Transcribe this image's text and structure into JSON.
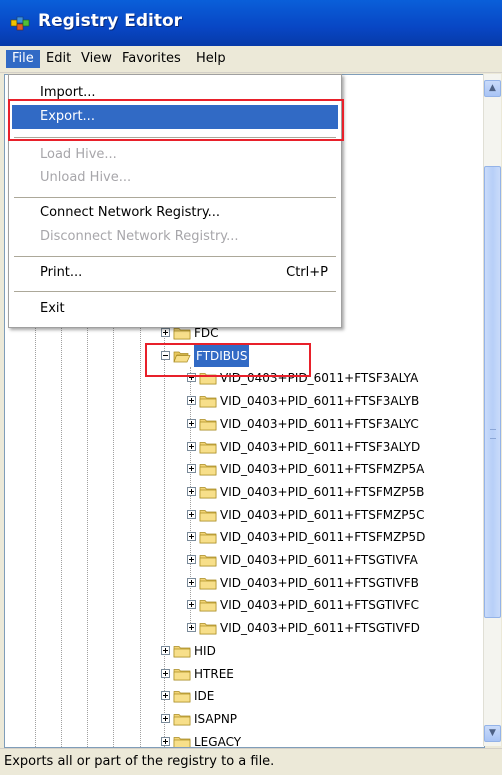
{
  "window": {
    "title": "Registry Editor"
  },
  "menubar": [
    "File",
    "Edit",
    "View",
    "Favorites",
    "Help"
  ],
  "file_menu": {
    "items": [
      {
        "label": "Import...",
        "shortcut": "",
        "state": "normal"
      },
      {
        "label": "Export...",
        "shortcut": "",
        "state": "hover"
      },
      {
        "label": "Load Hive...",
        "shortcut": "",
        "state": "disabled"
      },
      {
        "label": "Unload Hive...",
        "shortcut": "",
        "state": "disabled"
      },
      {
        "label": "Connect Network Registry...",
        "shortcut": "",
        "state": "normal"
      },
      {
        "label": "Disconnect Network Registry...",
        "shortcut": "",
        "state": "disabled"
      },
      {
        "label": "Print...",
        "shortcut": "Ctrl+P",
        "state": "normal"
      },
      {
        "label": "Exit",
        "shortcut": "",
        "state": "normal"
      }
    ]
  },
  "tree": {
    "nodes": [
      {
        "label": "FDC",
        "state": "collapsed"
      },
      {
        "label": "FTDIBUS",
        "state": "expanded",
        "selected": true
      },
      {
        "label": "VID_0403+PID_6011+FTSF3ALYA",
        "state": "collapsed"
      },
      {
        "label": "VID_0403+PID_6011+FTSF3ALYB",
        "state": "collapsed"
      },
      {
        "label": "VID_0403+PID_6011+FTSF3ALYC",
        "state": "collapsed"
      },
      {
        "label": "VID_0403+PID_6011+FTSF3ALYD",
        "state": "collapsed"
      },
      {
        "label": "VID_0403+PID_6011+FTSFMZP5A",
        "state": "collapsed"
      },
      {
        "label": "VID_0403+PID_6011+FTSFMZP5B",
        "state": "collapsed"
      },
      {
        "label": "VID_0403+PID_6011+FTSFMZP5C",
        "state": "collapsed"
      },
      {
        "label": "VID_0403+PID_6011+FTSFMZP5D",
        "state": "collapsed"
      },
      {
        "label": "VID_0403+PID_6011+FTSGTIVFA",
        "state": "collapsed"
      },
      {
        "label": "VID_0403+PID_6011+FTSGTIVFB",
        "state": "collapsed"
      },
      {
        "label": "VID_0403+PID_6011+FTSGTIVFC",
        "state": "collapsed"
      },
      {
        "label": "VID_0403+PID_6011+FTSGTIVFD",
        "state": "collapsed"
      },
      {
        "label": "HID",
        "state": "collapsed"
      },
      {
        "label": "HTREE",
        "state": "collapsed"
      },
      {
        "label": "IDE",
        "state": "collapsed"
      },
      {
        "label": "ISAPNP",
        "state": "collapsed"
      },
      {
        "label": "LEGACY",
        "state": "collapsed"
      }
    ]
  },
  "statusbar": {
    "text": "Exports all or part of the registry to a file."
  },
  "colors": {
    "title_bar": "#0a5fd9",
    "selection": "#316ac5",
    "highlight_box": "#e8202a",
    "chrome": "#ece9d8"
  }
}
